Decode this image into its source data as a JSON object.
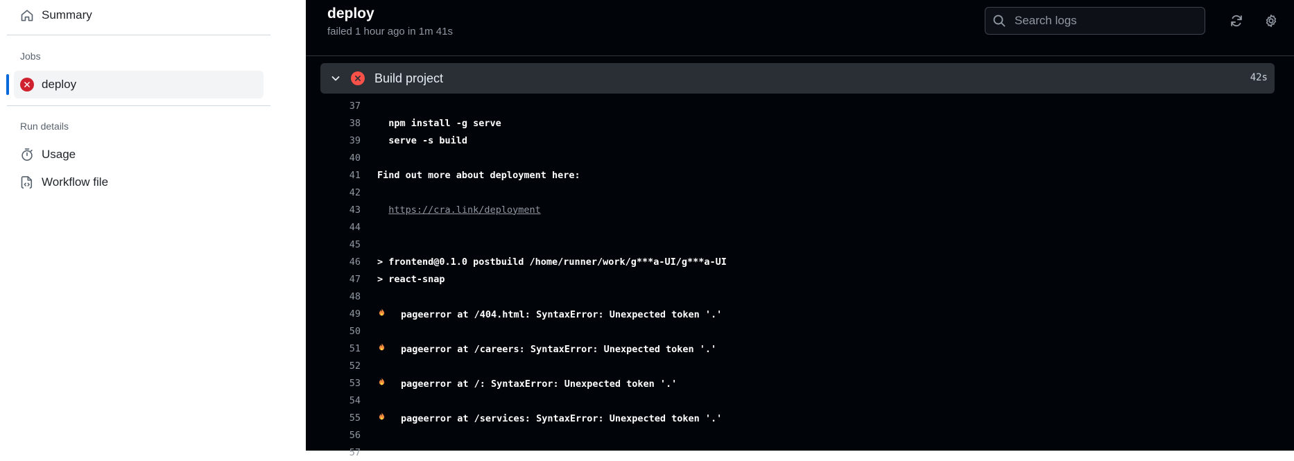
{
  "sidebar": {
    "summary_label": "Summary",
    "jobs_heading": "Jobs",
    "job_label": "deploy",
    "run_details_heading": "Run details",
    "usage_label": "Usage",
    "workflow_file_label": "Workflow file"
  },
  "header": {
    "job_title": "deploy",
    "job_subtitle": "failed 1 hour ago in 1m 41s",
    "search_placeholder": "Search logs"
  },
  "step": {
    "name": "Build project",
    "duration": "42s"
  },
  "log_lines": [
    {
      "num": "37",
      "text": ""
    },
    {
      "num": "38",
      "text": "  npm install -g serve"
    },
    {
      "num": "39",
      "text": "  serve -s build"
    },
    {
      "num": "40",
      "text": ""
    },
    {
      "num": "41",
      "text": "Find out more about deployment here:"
    },
    {
      "num": "42",
      "text": ""
    },
    {
      "num": "43",
      "text": "  ",
      "link": "https://cra.link/deployment"
    },
    {
      "num": "44",
      "text": ""
    },
    {
      "num": "45",
      "text": ""
    },
    {
      "num": "46",
      "text": "> frontend@0.1.0 postbuild /home/runner/work/g***a-UI/g***a-UI"
    },
    {
      "num": "47",
      "text": "> react-snap"
    },
    {
      "num": "48",
      "text": ""
    },
    {
      "num": "49",
      "fire": true,
      "text": "pageerror at /404.html: SyntaxError: Unexpected token '.'"
    },
    {
      "num": "50",
      "text": ""
    },
    {
      "num": "51",
      "fire": true,
      "text": "pageerror at /careers: SyntaxError: Unexpected token '.'"
    },
    {
      "num": "52",
      "text": ""
    },
    {
      "num": "53",
      "fire": true,
      "text": "pageerror at /: SyntaxError: Unexpected token '.'"
    },
    {
      "num": "54",
      "text": ""
    },
    {
      "num": "55",
      "fire": true,
      "text": "pageerror at /services: SyntaxError: Unexpected token '.'"
    },
    {
      "num": "56",
      "text": ""
    },
    {
      "num": "57",
      "text": ""
    }
  ],
  "colors": {
    "accent": "#0969da",
    "failure": "#cf222e",
    "log_background": "#010409"
  }
}
